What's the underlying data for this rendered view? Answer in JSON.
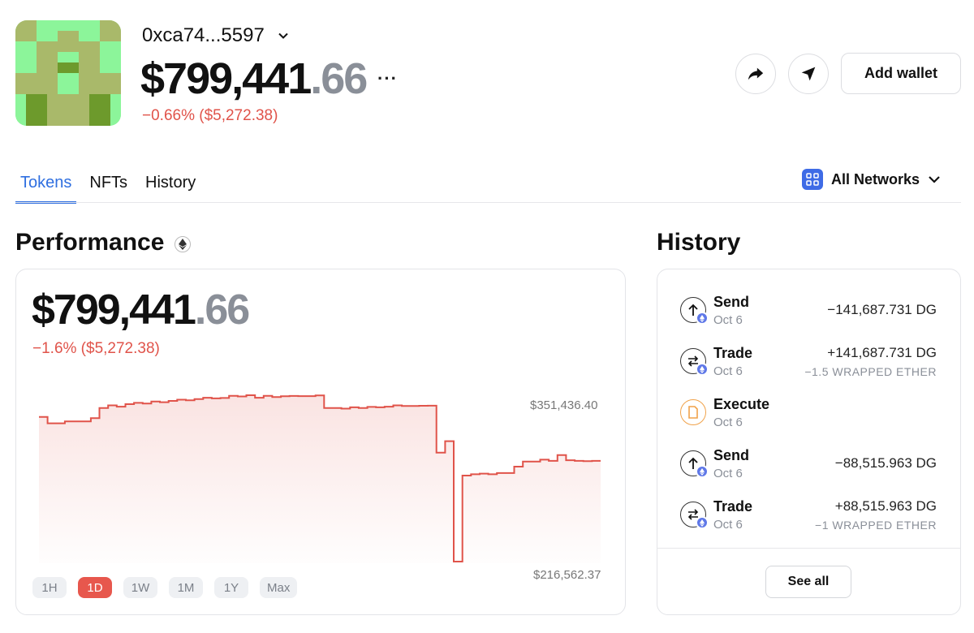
{
  "header": {
    "wallet_name": "0xca74...5597",
    "balance_main": "$799,441",
    "balance_cents": ".66",
    "more": "···",
    "change": "−0.66% ($5,272.38)",
    "add_wallet_label": "Add wallet"
  },
  "tabs": [
    {
      "label": "Tokens",
      "active": true
    },
    {
      "label": "NFTs",
      "active": false
    },
    {
      "label": "History",
      "active": false
    }
  ],
  "network_filter": {
    "label": "All Networks"
  },
  "performance": {
    "title": "Performance",
    "balance_main": "$799,441",
    "balance_cents": ".66",
    "change": "−1.6% ($5,272.38)",
    "ranges": [
      "1H",
      "1D",
      "1W",
      "1M",
      "1Y",
      "Max"
    ],
    "selected_range": "1D"
  },
  "chart_data": {
    "type": "line",
    "ymax_label": "$351,436.40",
    "ymin_label": "$216,562.37",
    "ylim": [
      216562.37,
      351436.4
    ],
    "color": "#e0534a",
    "values": [
      330000,
      325000,
      325000,
      326500,
      326500,
      326500,
      329000,
      337000,
      339000,
      338000,
      340000,
      341000,
      340500,
      342000,
      341500,
      342500,
      343500,
      343000,
      344000,
      345000,
      344500,
      344800,
      346500,
      346000,
      347000,
      345000,
      346500,
      345500,
      346200,
      346400,
      346300,
      346300,
      346800,
      337000,
      337000,
      336500,
      337500,
      337000,
      337800,
      337500,
      338000,
      339000,
      338500,
      338600,
      338700,
      338800,
      302000,
      311000,
      216562,
      284000,
      285000,
      285500,
      285000,
      286000,
      286000,
      291000,
      295000,
      295000,
      296500,
      295500,
      300000,
      296000,
      295500,
      295300,
      295500,
      295500
    ]
  },
  "history": {
    "title": "History",
    "items": [
      {
        "type": "Send",
        "date": "Oct 6",
        "amount": "−141,687.731 DG",
        "sub": "",
        "icon": "send"
      },
      {
        "type": "Trade",
        "date": "Oct 6",
        "amount": "+141,687.731 DG",
        "sub": "−1.5 WRAPPED ETHER",
        "icon": "trade"
      },
      {
        "type": "Execute",
        "date": "Oct 6",
        "amount": "",
        "sub": "",
        "icon": "execute"
      },
      {
        "type": "Send",
        "date": "Oct 6",
        "amount": "−88,515.963 DG",
        "sub": "",
        "icon": "send"
      },
      {
        "type": "Trade",
        "date": "Oct 6",
        "amount": "+88,515.963 DG",
        "sub": "−1 WRAPPED ETHER",
        "icon": "trade"
      }
    ],
    "see_all_label": "See all"
  }
}
